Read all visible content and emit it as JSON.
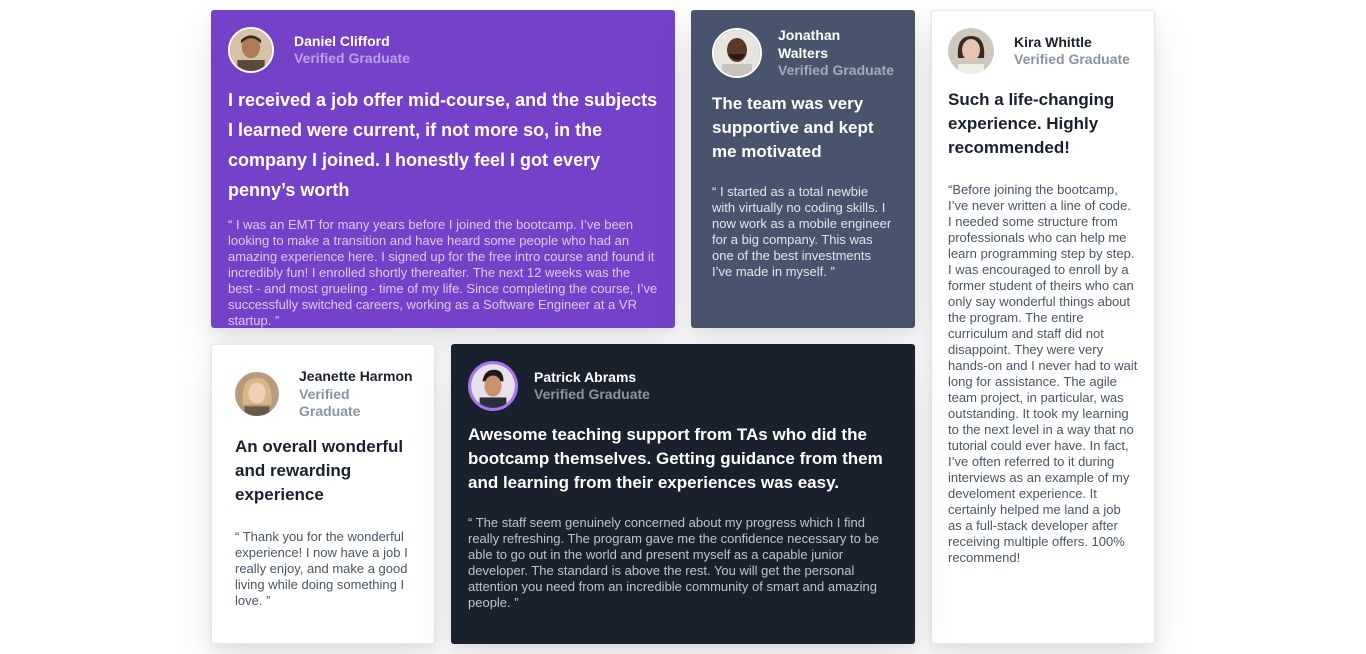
{
  "testimonials": [
    {
      "name": "Daniel Clifford",
      "role": "Verified Graduate",
      "headline": "I received a job offer mid-course, and the subjects I learned were current, if not more so, in the company I joined. I honestly feel I got every penny’s worth",
      "quote": "“ I was an EMT for many years before I joined the bootcamp. I’ve been looking to make a transition and have heard some people who had an amazing experience here. I signed up for the free intro course and found it incredibly fun! I enrolled shortly thereafter. The next 12 weeks was the best - and most grueling - time of my life. Since completing the course, I’ve successfully switched careers, working as a Software Engineer at a VR startup. ”"
    },
    {
      "name": "Jonathan Walters",
      "role": "Verified Graduate",
      "headline": "The team was very supportive and kept me motivated",
      "quote": "“ I started as a total newbie with virtually no coding skills. I now work as a mobile engineer for a big company. This was one of the best investments I’ve made in myself. ”"
    },
    {
      "name": "Kira Whittle",
      "role": "Verified Graduate",
      "headline": "Such a life-changing experience. Highly recommended!",
      "quote": "“Before joining the bootcamp, I’ve never written a line of code. I needed some structure from professionals who can help me learn programming step by step. I was encouraged to enroll by a former student of theirs who can only say wonderful things about the program. The entire curriculum and staff did not disappoint. They were very hands-on and I never had to wait long for assistance. The agile team project, in particular, was outstanding. It took my learning to the next level in a way that no tutorial could ever have. In fact, I’ve often referred to it during interviews as an example of my develoment experience. It certainly helped me land a job as a full-stack developer after receiving multiple offers. 100% recommend!"
    },
    {
      "name": "Jeanette Harmon",
      "role": "Verified Graduate",
      "headline": "An overall wonderful and rewarding experience",
      "quote": "“ Thank you for the wonderful experience! I now have a job I really enjoy, and make a good living while doing something I love. ”"
    },
    {
      "name": "Patrick Abrams",
      "role": "Verified Graduate",
      "headline": "Awesome teaching support from TAs who did the bootcamp themselves. Getting guidance from them and learning from their experiences was easy.",
      "quote": "“ The staff seem genuinely concerned about my progress which I find really refreshing. The program gave me the confidence necessary to be able to go out in the world and present myself as a capable junior developer. The standard is above the rest. You will get the personal attention you need from an incredible community of smart and amazing people. ”"
    }
  ],
  "colors": {
    "purple": "#7442c8",
    "gray": "#48546b",
    "dark": "#19212e",
    "white": "#ffffff"
  }
}
